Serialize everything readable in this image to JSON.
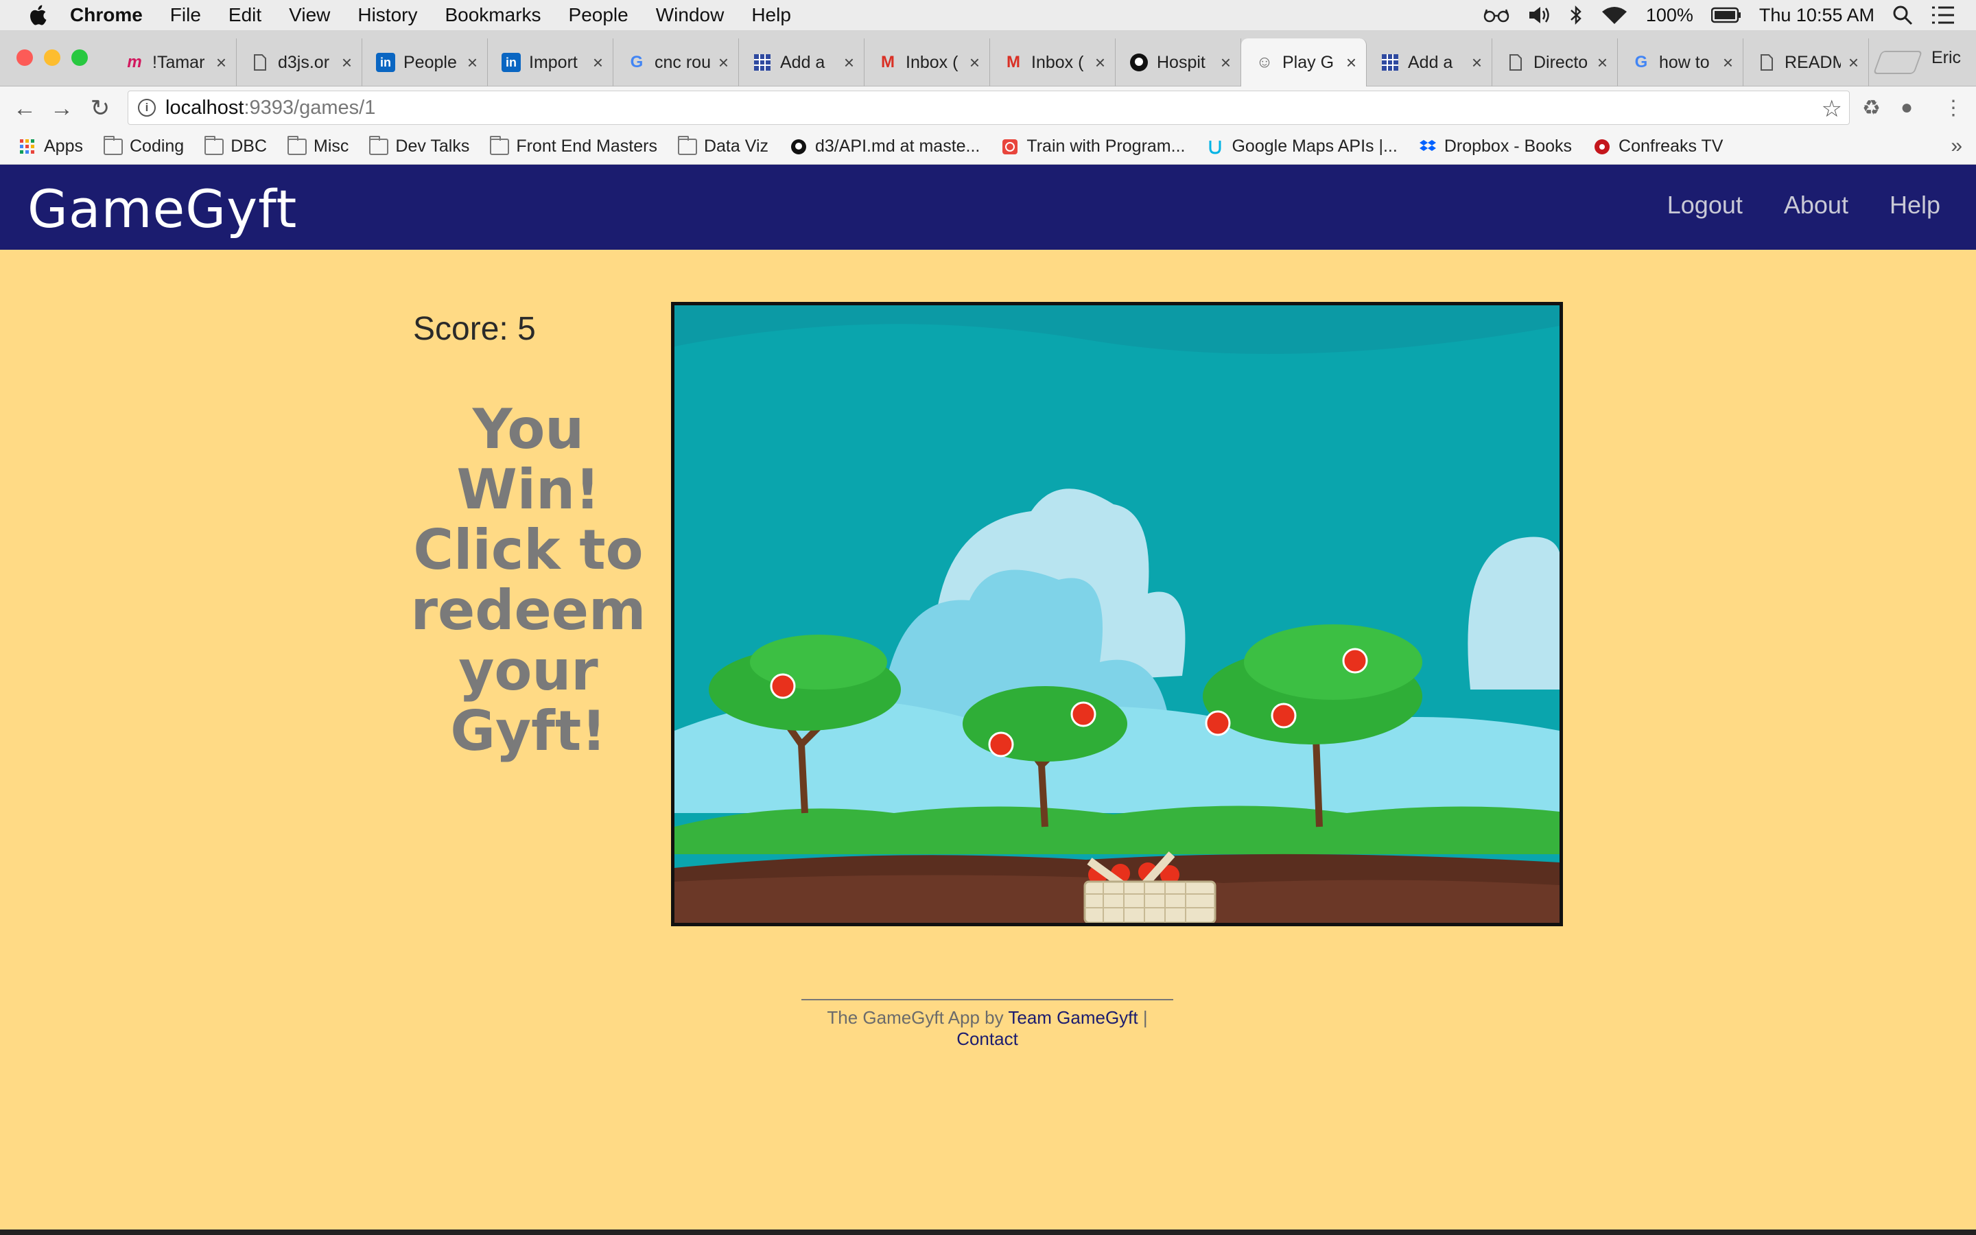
{
  "menubar": {
    "app": "Chrome",
    "items": [
      "File",
      "Edit",
      "View",
      "History",
      "Bookmarks",
      "People",
      "Window",
      "Help"
    ],
    "battery": "100%",
    "clock": "Thu 10:55 AM"
  },
  "tabs": [
    {
      "label": "!Tamar",
      "icon": "m-icon"
    },
    {
      "label": "d3js.or",
      "icon": "page-icon"
    },
    {
      "label": "People",
      "icon": "linkedin-icon"
    },
    {
      "label": "Import",
      "icon": "linkedin-icon"
    },
    {
      "label": "cnc rou",
      "icon": "google-icon"
    },
    {
      "label": "Add a",
      "icon": "grid-icon"
    },
    {
      "label": "Inbox (",
      "icon": "gmail-icon"
    },
    {
      "label": "Inbox (",
      "icon": "gmail-icon"
    },
    {
      "label": "Hospit",
      "icon": "github-icon"
    },
    {
      "label": "Play G",
      "icon": "smile-icon",
      "active": true
    },
    {
      "label": "Add a",
      "icon": "grid-icon"
    },
    {
      "label": "Directo",
      "icon": "page-icon"
    },
    {
      "label": "how to",
      "icon": "google-icon"
    },
    {
      "label": "READM",
      "icon": "page-icon"
    }
  ],
  "profile": "Eric",
  "address": {
    "host": "localhost",
    "path": ":9393/games/1"
  },
  "bookmarks": [
    {
      "label": "Apps",
      "icon": "apps-grid-icon"
    },
    {
      "label": "Coding",
      "icon": "folder-icon"
    },
    {
      "label": "DBC",
      "icon": "folder-icon"
    },
    {
      "label": "Misc",
      "icon": "folder-icon"
    },
    {
      "label": "Dev Talks",
      "icon": "folder-icon"
    },
    {
      "label": "Front End Masters",
      "icon": "folder-icon"
    },
    {
      "label": "Data Viz",
      "icon": "folder-icon"
    },
    {
      "label": "d3/API.md at maste...",
      "icon": "github-icon"
    },
    {
      "label": "Train with Program...",
      "icon": "spiral-icon"
    },
    {
      "label": "Google Maps APIs |...",
      "icon": "udacity-icon"
    },
    {
      "label": "Dropbox - Books",
      "icon": "dropbox-icon"
    },
    {
      "label": "Confreaks TV",
      "icon": "confreaks-icon"
    }
  ],
  "app": {
    "brand": "GameGyft",
    "nav": [
      "Logout",
      "About",
      "Help"
    ]
  },
  "game": {
    "score_label": "Score: 5",
    "win_message": "You Win! Click to redeem your Gyft!"
  },
  "footer": {
    "text": "The GameGyft App by",
    "team_link": "Team GameGyft",
    "separator": "|",
    "contact_link": "Contact"
  },
  "colors": {
    "page_bg": "#ffda85",
    "nav_bg": "#1b1c6f",
    "sky": "#0aa5ad",
    "win_text": "#7a7a7a"
  }
}
